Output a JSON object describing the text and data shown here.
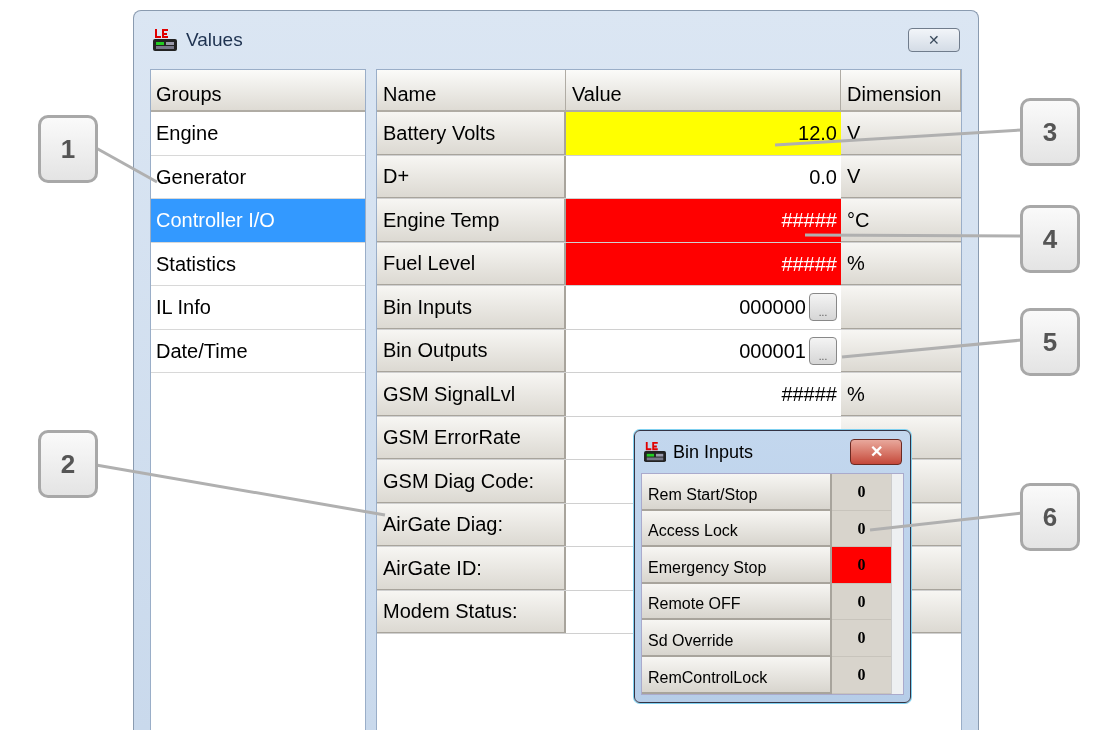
{
  "window": {
    "title": "Values",
    "close_label": "✕"
  },
  "groups": {
    "heading": "Groups",
    "items": [
      {
        "label": "Engine",
        "selected": false
      },
      {
        "label": "Generator",
        "selected": false
      },
      {
        "label": "Controller I/O",
        "selected": true
      },
      {
        "label": "Statistics",
        "selected": false
      },
      {
        "label": "IL Info",
        "selected": false
      },
      {
        "label": "Date/Time",
        "selected": false
      }
    ]
  },
  "table": {
    "columns": [
      "Name",
      "Value",
      "Dimension"
    ],
    "rows": [
      {
        "name": "Battery Volts",
        "value": "12.0",
        "dimension": "V",
        "color": "#ffff00"
      },
      {
        "name": "D+",
        "value": "0.0",
        "dimension": "V"
      },
      {
        "name": "Engine Temp",
        "value": "#####",
        "dimension": "°C",
        "color": "#ff0000"
      },
      {
        "name": "Fuel Level",
        "value": "#####",
        "dimension": "%",
        "color": "#ff0000"
      },
      {
        "name": "Bin Inputs",
        "value": "000000",
        "button": "..."
      },
      {
        "name": "Bin Outputs",
        "value": "000001",
        "button": "..."
      },
      {
        "name": "GSM SignalLvl",
        "value": "#####",
        "dimension": "%"
      },
      {
        "name": "GSM ErrorRate"
      },
      {
        "name": "GSM Diag Code:"
      },
      {
        "name": "AirGate Diag:"
      },
      {
        "name": "AirGate ID:"
      },
      {
        "name": "Modem Status:"
      }
    ]
  },
  "popup": {
    "title": "Bin Inputs",
    "close_label": "✕",
    "rows": [
      {
        "name": "Rem Start/Stop",
        "value": "0"
      },
      {
        "name": "Access Lock",
        "value": "0"
      },
      {
        "name": "Emergency Stop",
        "value": "0",
        "color": "#ff0000"
      },
      {
        "name": "Remote OFF",
        "value": "0"
      },
      {
        "name": "Sd Override",
        "value": "0"
      },
      {
        "name": "RemControlLock",
        "value": "0"
      }
    ]
  },
  "callouts": [
    "1",
    "2",
    "3",
    "4",
    "5",
    "6"
  ]
}
